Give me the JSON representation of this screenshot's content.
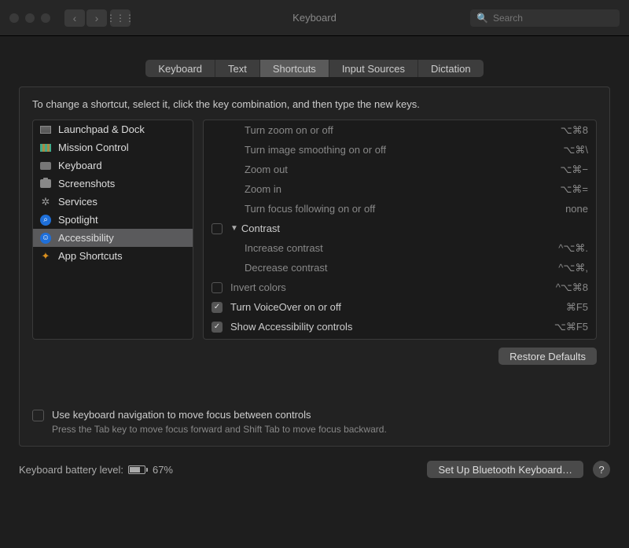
{
  "window": {
    "title": "Keyboard",
    "search_placeholder": "Search"
  },
  "tabs": [
    {
      "label": "Keyboard",
      "active": false
    },
    {
      "label": "Text",
      "active": false
    },
    {
      "label": "Shortcuts",
      "active": true
    },
    {
      "label": "Input Sources",
      "active": false
    },
    {
      "label": "Dictation",
      "active": false
    }
  ],
  "instruction": "To change a shortcut, select it, click the key combination, and then type the new keys.",
  "categories": [
    {
      "label": "Launchpad & Dock",
      "icon": "launchpad",
      "active": false
    },
    {
      "label": "Mission Control",
      "icon": "mission",
      "active": false
    },
    {
      "label": "Keyboard",
      "icon": "keyboard",
      "active": false
    },
    {
      "label": "Screenshots",
      "icon": "screenshot",
      "active": false
    },
    {
      "label": "Services",
      "icon": "services",
      "active": false
    },
    {
      "label": "Spotlight",
      "icon": "spotlight",
      "active": false
    },
    {
      "label": "Accessibility",
      "icon": "accessibility",
      "active": true
    },
    {
      "label": "App Shortcuts",
      "icon": "apps",
      "active": false
    }
  ],
  "shortcuts": [
    {
      "name": "Turn zoom on or off",
      "keys": "⌥⌘8",
      "checked": null,
      "indent": 1,
      "dim": true
    },
    {
      "name": "Turn image smoothing on or off",
      "keys": "⌥⌘\\",
      "checked": null,
      "indent": 1,
      "dim": true
    },
    {
      "name": "Zoom out",
      "keys": "⌥⌘−",
      "checked": null,
      "indent": 1,
      "dim": true
    },
    {
      "name": "Zoom in",
      "keys": "⌥⌘=",
      "checked": null,
      "indent": 1,
      "dim": true
    },
    {
      "name": "Turn focus following on or off",
      "keys": "none",
      "checked": null,
      "indent": 1,
      "dim": true
    },
    {
      "name": "Contrast",
      "keys": "",
      "checked": false,
      "indent": 0,
      "dim": false,
      "group": true
    },
    {
      "name": "Increase contrast",
      "keys": "^⌥⌘.",
      "checked": null,
      "indent": 1,
      "dim": true
    },
    {
      "name": "Decrease contrast",
      "keys": "^⌥⌘,",
      "checked": null,
      "indent": 1,
      "dim": true
    },
    {
      "name": "Invert colors",
      "keys": "^⌥⌘8",
      "checked": false,
      "indent": 0,
      "dim": true
    },
    {
      "name": "Turn VoiceOver on or off",
      "keys": "⌘F5",
      "checked": true,
      "indent": 0,
      "dim": false
    },
    {
      "name": "Show Accessibility controls",
      "keys": "⌥⌘F5",
      "checked": true,
      "indent": 0,
      "dim": false
    }
  ],
  "restore_label": "Restore Defaults",
  "nav_check": {
    "line1": "Use keyboard navigation to move focus between controls",
    "line2": "Press the Tab key to move focus forward and Shift Tab to move focus backward."
  },
  "footer": {
    "battery_label": "Keyboard battery level:",
    "battery_pct": "67%",
    "bluetooth_label": "Set Up Bluetooth Keyboard…",
    "help": "?"
  }
}
